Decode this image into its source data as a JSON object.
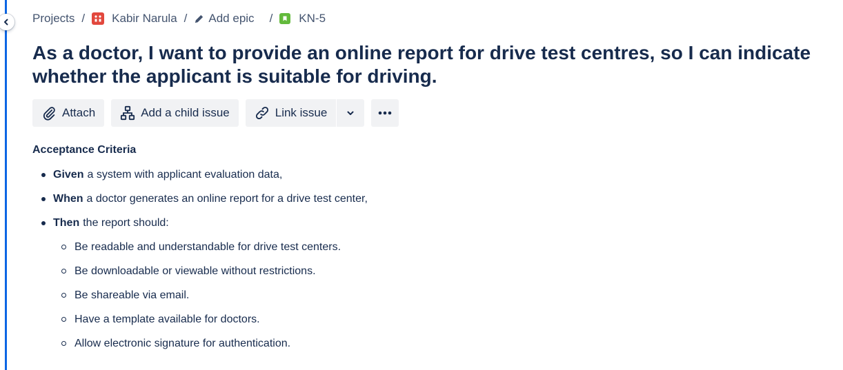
{
  "breadcrumb": {
    "projects": "Projects",
    "project_name": "Kabir Narula",
    "epic": "Add epic",
    "issue_key": "KN-5",
    "separator": "/"
  },
  "issue": {
    "title": "As a doctor, I want to provide an online report for drive test centres, so I can indicate whether the applicant is suitable for driving."
  },
  "toolbar": {
    "attach": "Attach",
    "add_child": "Add a child issue",
    "link_issue": "Link issue"
  },
  "description": {
    "heading": "Acceptance Criteria",
    "items": [
      {
        "keyword": "Given",
        "text": "a system with applicant evaluation data,"
      },
      {
        "keyword": "When",
        "text": "a doctor generates an online report for a drive test center,"
      },
      {
        "keyword": "Then",
        "text": "the report should:"
      }
    ],
    "sub_items": [
      "Be readable and understandable for drive test centers.",
      "Be downloadable or viewable without restrictions.",
      "Be shareable via email.",
      "Have a template available for doctors.",
      "Allow electronic signature for authentication."
    ]
  },
  "colors": {
    "accent": "#0c66e4",
    "project_icon": "#e2483d",
    "story_icon": "#63ba3c",
    "text": "#172b4d",
    "button_bg": "#f1f2f4"
  },
  "icons": {
    "collapse": "chevron-left-icon",
    "project": "project-avatar-icon",
    "epic": "pencil-icon",
    "issue_type": "story-icon",
    "attach": "paperclip-icon",
    "child": "hierarchy-icon",
    "link": "link-icon",
    "dropdown": "chevron-down-icon",
    "more": "more-icon"
  }
}
